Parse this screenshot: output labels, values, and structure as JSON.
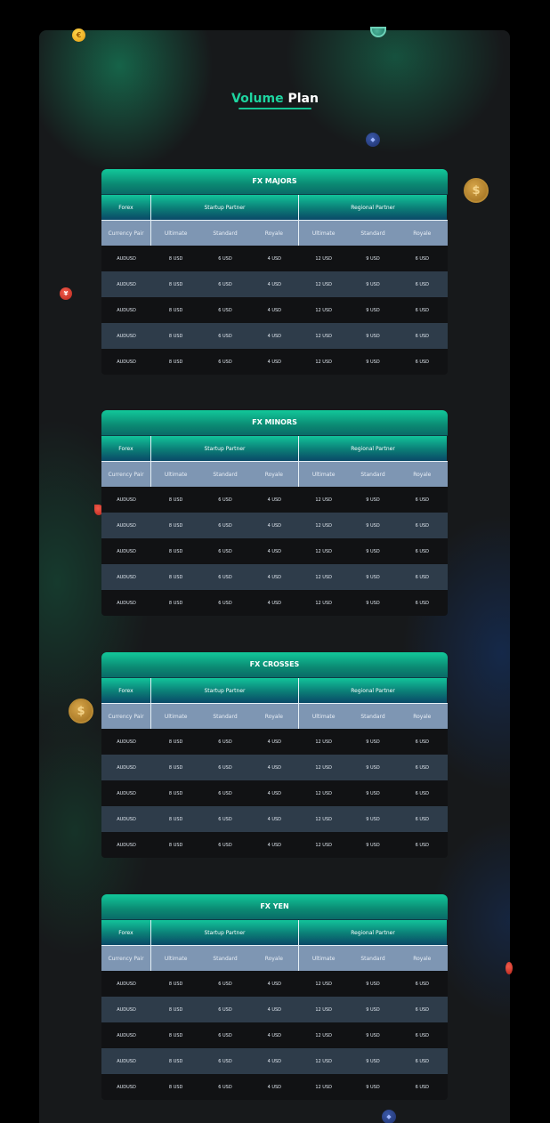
{
  "page": {
    "title_accent": "Volume",
    "title_rest": "Plan"
  },
  "colors": {
    "accent": "#1ed4a0",
    "header_gradient_top": "#12c39a",
    "header_gradient_bottom": "#0a4968",
    "subheader": "#7e96b3",
    "row_dark": "#111214",
    "row_light": "#2e3c4a",
    "background": "#17191b"
  },
  "decor": {
    "coin_dollar_symbol": "$",
    "coin_yen_symbol": "¥",
    "coin_tether_symbol": "T",
    "coin_eth_symbol": "◆",
    "coin_euro_symbol": "€"
  },
  "tables": [
    {
      "title": "FX MAJORS",
      "forex_label": "Forex",
      "groups": [
        "Startup Partner",
        "Regional Partner"
      ],
      "sub_headers": [
        "Currency Pair",
        "Ultimate",
        "Standard",
        "Royale",
        "Ultimate",
        "Standard",
        "Royale"
      ],
      "rows": [
        [
          "AUDUSD",
          "8 USD",
          "6 USD",
          "4 USD",
          "12 USD",
          "9 USD",
          "6 USD"
        ],
        [
          "AUDUSD",
          "8 USD",
          "6 USD",
          "4 USD",
          "12 USD",
          "9 USD",
          "6 USD"
        ],
        [
          "AUDUSD",
          "8 USD",
          "6 USD",
          "4 USD",
          "12 USD",
          "9 USD",
          "6 USD"
        ],
        [
          "AUDUSD",
          "8 USD",
          "6 USD",
          "4 USD",
          "12 USD",
          "9 USD",
          "6 USD"
        ],
        [
          "AUDUSD",
          "8 USD",
          "6 USD",
          "4 USD",
          "12 USD",
          "9 USD",
          "6 USD"
        ]
      ]
    },
    {
      "title": "FX MINORS",
      "forex_label": "Forex",
      "groups": [
        "Startup Partner",
        "Regional Partner"
      ],
      "sub_headers": [
        "Currency Pair",
        "Ultimate",
        "Standard",
        "Royale",
        "Ultimate",
        "Standard",
        "Royale"
      ],
      "rows": [
        [
          "AUDUSD",
          "8 USD",
          "6 USD",
          "4 USD",
          "12 USD",
          "9 USD",
          "6 USD"
        ],
        [
          "AUDUSD",
          "8 USD",
          "6 USD",
          "4 USD",
          "12 USD",
          "9 USD",
          "6 USD"
        ],
        [
          "AUDUSD",
          "8 USD",
          "6 USD",
          "4 USD",
          "12 USD",
          "9 USD",
          "6 USD"
        ],
        [
          "AUDUSD",
          "8 USD",
          "6 USD",
          "4 USD",
          "12 USD",
          "9 USD",
          "6 USD"
        ],
        [
          "AUDUSD",
          "8 USD",
          "6 USD",
          "4 USD",
          "12 USD",
          "9 USD",
          "6 USD"
        ]
      ]
    },
    {
      "title": "FX CROSSES",
      "forex_label": "Forex",
      "groups": [
        "Startup Partner",
        "Regional Partner"
      ],
      "sub_headers": [
        "Currency Pair",
        "Ultimate",
        "Standard",
        "Royale",
        "Ultimate",
        "Standard",
        "Royale"
      ],
      "rows": [
        [
          "AUDUSD",
          "8 USD",
          "6 USD",
          "4 USD",
          "12 USD",
          "9 USD",
          "6 USD"
        ],
        [
          "AUDUSD",
          "8 USD",
          "6 USD",
          "4 USD",
          "12 USD",
          "9 USD",
          "6 USD"
        ],
        [
          "AUDUSD",
          "8 USD",
          "6 USD",
          "4 USD",
          "12 USD",
          "9 USD",
          "6 USD"
        ],
        [
          "AUDUSD",
          "8 USD",
          "6 USD",
          "4 USD",
          "12 USD",
          "9 USD",
          "6 USD"
        ],
        [
          "AUDUSD",
          "8 USD",
          "6 USD",
          "4 USD",
          "12 USD",
          "9 USD",
          "6 USD"
        ]
      ]
    },
    {
      "title": "FX YEN",
      "forex_label": "Forex",
      "groups": [
        "Startup Partner",
        "Regional Partner"
      ],
      "sub_headers": [
        "Currency Pair",
        "Ultimate",
        "Standard",
        "Royale",
        "Ultimate",
        "Standard",
        "Royale"
      ],
      "rows": [
        [
          "AUDUSD",
          "8 USD",
          "6 USD",
          "4 USD",
          "12 USD",
          "9 USD",
          "6 USD"
        ],
        [
          "AUDUSD",
          "8 USD",
          "6 USD",
          "4 USD",
          "12 USD",
          "9 USD",
          "6 USD"
        ],
        [
          "AUDUSD",
          "8 USD",
          "6 USD",
          "4 USD",
          "12 USD",
          "9 USD",
          "6 USD"
        ],
        [
          "AUDUSD",
          "8 USD",
          "6 USD",
          "4 USD",
          "12 USD",
          "9 USD",
          "6 USD"
        ],
        [
          "AUDUSD",
          "8 USD",
          "6 USD",
          "4 USD",
          "12 USD",
          "9 USD",
          "6 USD"
        ]
      ]
    }
  ]
}
